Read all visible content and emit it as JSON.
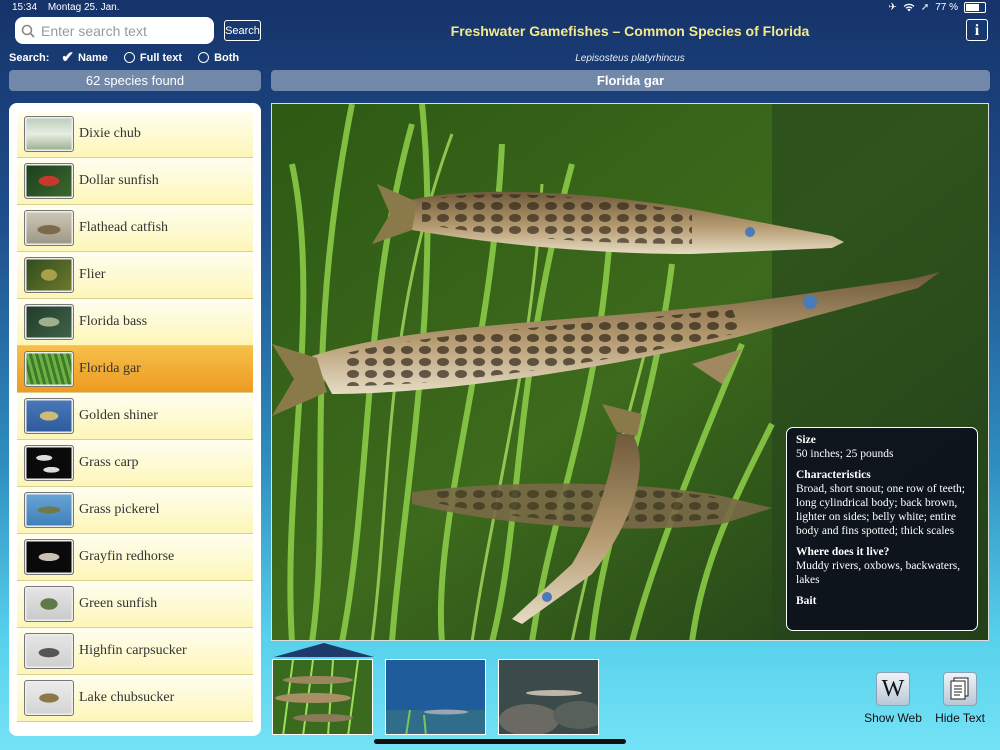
{
  "status_bar": {
    "time": "15:34",
    "date": "Montag 25. Jan.",
    "battery": "77 %",
    "battery_level": 0.77
  },
  "search": {
    "placeholder": "Enter search text",
    "value": "",
    "button_label": "Search",
    "label": "Search:",
    "options": [
      {
        "label": "Name",
        "selected": true
      },
      {
        "label": "Full text",
        "selected": false
      },
      {
        "label": "Both",
        "selected": false
      }
    ]
  },
  "results": {
    "count_text": "62 species found"
  },
  "header": {
    "title": "Freshwater Gamefishes – Common Species of Florida",
    "info_label": "i"
  },
  "species": {
    "latin_name": "Lepisosteus platyrhincus",
    "common_name": "Florida gar"
  },
  "list": {
    "items": [
      {
        "label": "Dixie chub",
        "selected": false
      },
      {
        "label": "Dollar sunfish",
        "selected": false
      },
      {
        "label": "Flathead catfish",
        "selected": false
      },
      {
        "label": "Flier",
        "selected": false
      },
      {
        "label": "Florida bass",
        "selected": false
      },
      {
        "label": "Florida gar",
        "selected": true
      },
      {
        "label": "Golden shiner",
        "selected": false
      },
      {
        "label": "Grass carp",
        "selected": false
      },
      {
        "label": "Grass pickerel",
        "selected": false
      },
      {
        "label": "Grayfin redhorse",
        "selected": false
      },
      {
        "label": "Green sunfish",
        "selected": false
      },
      {
        "label": "Highfin carpsucker",
        "selected": false
      },
      {
        "label": "Lake chubsucker",
        "selected": false
      }
    ]
  },
  "info": {
    "size_heading": "Size",
    "size_text": "50 inches; 25 pounds",
    "characteristics_heading": "Characteristics",
    "characteristics_text": "Broad, short snout; one row of teeth; long cylindrical body; back brown, lighter on sides; belly white; entire body and fins spotted; thick scales",
    "habitat_heading": "Where does it live?",
    "habitat_text": "Muddy rivers, oxbows, backwaters, lakes",
    "bait_heading": "Bait"
  },
  "toolbar": {
    "web_label": "Show Web",
    "web_icon_text": "W",
    "text_label": "Hide Text"
  },
  "icons": {
    "search": "search-icon",
    "info": "info-icon",
    "web": "wikipedia-icon",
    "text": "document-icon"
  }
}
